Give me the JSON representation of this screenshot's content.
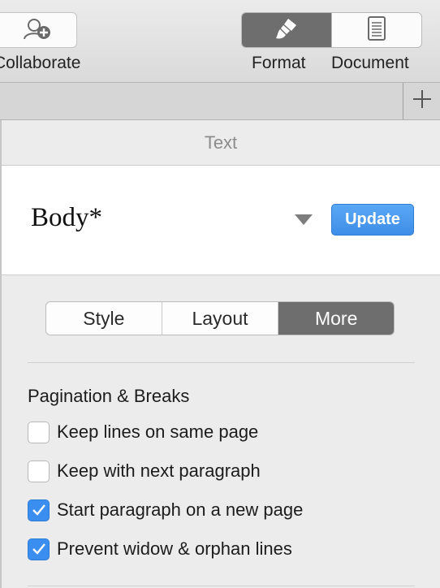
{
  "toolbar": {
    "collaborate_label": "Collaborate",
    "format_label": "Format",
    "document_label": "Document",
    "collaborate_icon": "collaborate-icon",
    "format_icon": "paintbrush-icon",
    "document_icon": "document-icon"
  },
  "tabstrip": {
    "add_icon": "plus-icon"
  },
  "panel": {
    "title": "Text",
    "style_name": "Body*",
    "update_label": "Update",
    "tabs": [
      {
        "label": "Style",
        "active": false
      },
      {
        "label": "Layout",
        "active": false
      },
      {
        "label": "More",
        "active": true
      }
    ],
    "section_title": "Pagination & Breaks",
    "options": [
      {
        "label": "Keep lines on same page",
        "checked": false
      },
      {
        "label": "Keep with next paragraph",
        "checked": false
      },
      {
        "label": "Start paragraph on a new page",
        "checked": true
      },
      {
        "label": "Prevent widow & orphan lines",
        "checked": true
      }
    ]
  },
  "colors": {
    "accent": "#3a8ef0",
    "active_segment": "#6e6e6e"
  }
}
